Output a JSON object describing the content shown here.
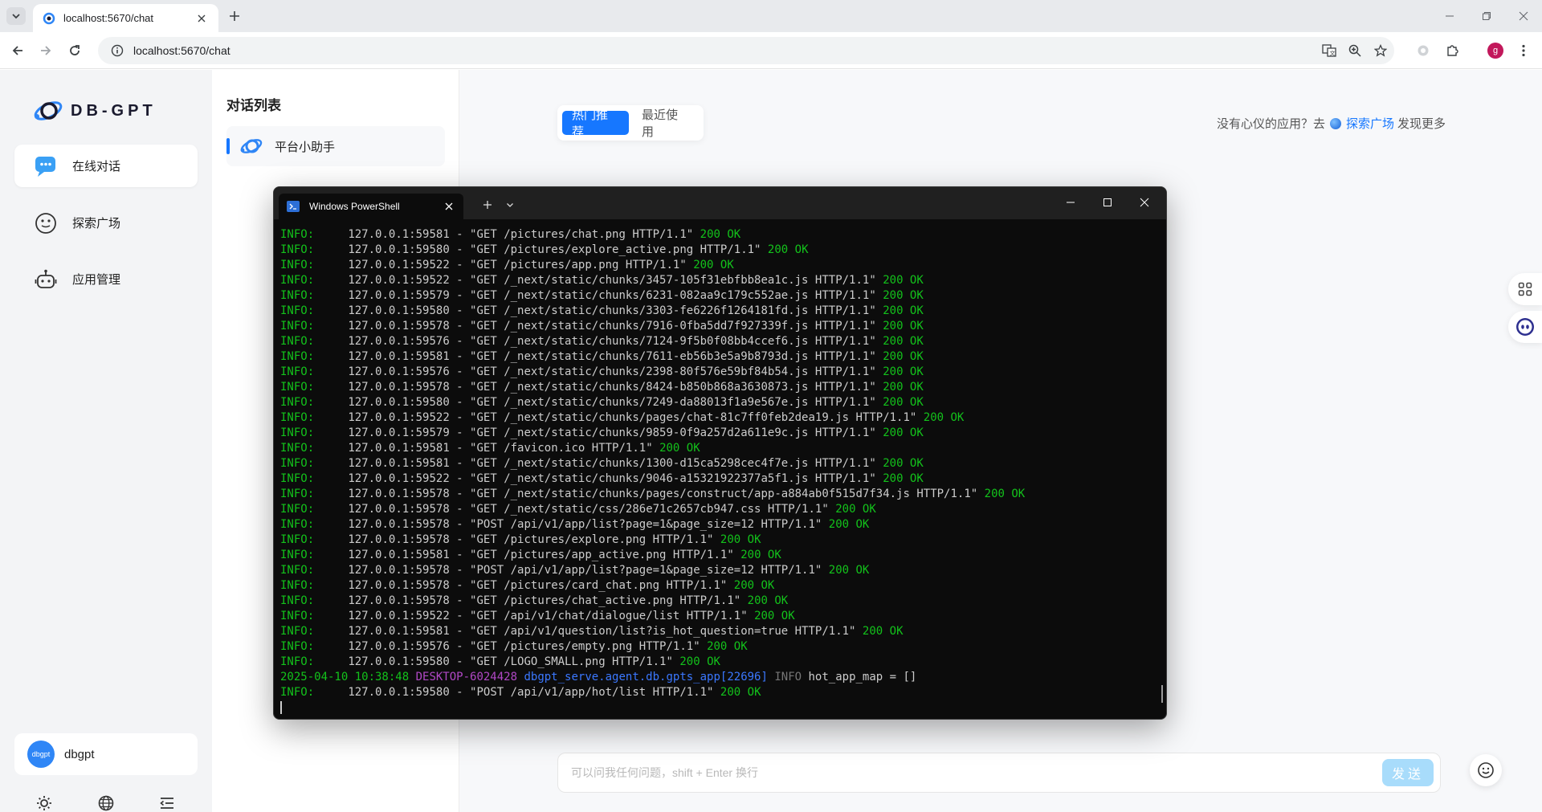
{
  "browser": {
    "tab_title": "localhost:5670/chat",
    "url": "localhost:5670/chat",
    "profile_initial": "g"
  },
  "sidebar": {
    "logo_text": "DB-GPT",
    "items": [
      {
        "label": "在线对话",
        "icon": "chat-bubble-icon",
        "active": true
      },
      {
        "label": "探索广场",
        "icon": "explore-face-icon",
        "active": false
      },
      {
        "label": "应用管理",
        "icon": "robot-icon",
        "active": false
      }
    ],
    "user": {
      "avatar_text": "dbgpt",
      "name": "dbgpt"
    }
  },
  "conversations": {
    "title": "对话列表",
    "items": [
      {
        "label": "平台小助手"
      }
    ]
  },
  "main": {
    "tabs": [
      {
        "label": "热门推荐",
        "active": true
      },
      {
        "label": "最近使用",
        "active": false
      }
    ],
    "hint_prefix": "没有心仪的应用？去",
    "hint_link": "探索广场",
    "hint_suffix": "发现更多",
    "input_placeholder": "可以问我任何问题，shift + Enter 换行",
    "send_label": "发送"
  },
  "powershell": {
    "tab_title": "Windows PowerShell",
    "lines": [
      {
        "lvl": "INFO:",
        "addr": "127.0.0.1:59581",
        "req": "\"GET /pictures/chat.png HTTP/1.1\"",
        "status": "200 OK"
      },
      {
        "lvl": "INFO:",
        "addr": "127.0.0.1:59580",
        "req": "\"GET /pictures/explore_active.png HTTP/1.1\"",
        "status": "200 OK"
      },
      {
        "lvl": "INFO:",
        "addr": "127.0.0.1:59522",
        "req": "\"GET /pictures/app.png HTTP/1.1\"",
        "status": "200 OK"
      },
      {
        "lvl": "INFO:",
        "addr": "127.0.0.1:59522",
        "req": "\"GET /_next/static/chunks/3457-105f31ebfbb8ea1c.js HTTP/1.1\"",
        "status": "200 OK"
      },
      {
        "lvl": "INFO:",
        "addr": "127.0.0.1:59579",
        "req": "\"GET /_next/static/chunks/6231-082aa9c179c552ae.js HTTP/1.1\"",
        "status": "200 OK"
      },
      {
        "lvl": "INFO:",
        "addr": "127.0.0.1:59580",
        "req": "\"GET /_next/static/chunks/3303-fe6226f1264181fd.js HTTP/1.1\"",
        "status": "200 OK"
      },
      {
        "lvl": "INFO:",
        "addr": "127.0.0.1:59578",
        "req": "\"GET /_next/static/chunks/7916-0fba5dd7f927339f.js HTTP/1.1\"",
        "status": "200 OK"
      },
      {
        "lvl": "INFO:",
        "addr": "127.0.0.1:59576",
        "req": "\"GET /_next/static/chunks/7124-9f5b0f08bb4ccef6.js HTTP/1.1\"",
        "status": "200 OK"
      },
      {
        "lvl": "INFO:",
        "addr": "127.0.0.1:59581",
        "req": "\"GET /_next/static/chunks/7611-eb56b3e5a9b8793d.js HTTP/1.1\"",
        "status": "200 OK"
      },
      {
        "lvl": "INFO:",
        "addr": "127.0.0.1:59576",
        "req": "\"GET /_next/static/chunks/2398-80f576e59bf84b54.js HTTP/1.1\"",
        "status": "200 OK"
      },
      {
        "lvl": "INFO:",
        "addr": "127.0.0.1:59578",
        "req": "\"GET /_next/static/chunks/8424-b850b868a3630873.js HTTP/1.1\"",
        "status": "200 OK"
      },
      {
        "lvl": "INFO:",
        "addr": "127.0.0.1:59580",
        "req": "\"GET /_next/static/chunks/7249-da88013f1a9e567e.js HTTP/1.1\"",
        "status": "200 OK"
      },
      {
        "lvl": "INFO:",
        "addr": "127.0.0.1:59522",
        "req": "\"GET /_next/static/chunks/pages/chat-81c7ff0feb2dea19.js HTTP/1.1\"",
        "status": "200 OK"
      },
      {
        "lvl": "INFO:",
        "addr": "127.0.0.1:59579",
        "req": "\"GET /_next/static/chunks/9859-0f9a257d2a611e9c.js HTTP/1.1\"",
        "status": "200 OK"
      },
      {
        "lvl": "INFO:",
        "addr": "127.0.0.1:59581",
        "req": "\"GET /favicon.ico HTTP/1.1\"",
        "status": "200 OK"
      },
      {
        "lvl": "INFO:",
        "addr": "127.0.0.1:59581",
        "req": "\"GET /_next/static/chunks/1300-d15ca5298cec4f7e.js HTTP/1.1\"",
        "status": "200 OK"
      },
      {
        "lvl": "INFO:",
        "addr": "127.0.0.1:59522",
        "req": "\"GET /_next/static/chunks/9046-a15321922377a5f1.js HTTP/1.1\"",
        "status": "200 OK"
      },
      {
        "lvl": "INFO:",
        "addr": "127.0.0.1:59578",
        "req": "\"GET /_next/static/chunks/pages/construct/app-a884ab0f515d7f34.js HTTP/1.1\"",
        "status": "200 OK"
      },
      {
        "lvl": "INFO:",
        "addr": "127.0.0.1:59578",
        "req": "\"GET /_next/static/css/286e71c2657cb947.css HTTP/1.1\"",
        "status": "200 OK"
      },
      {
        "lvl": "INFO:",
        "addr": "127.0.0.1:59578",
        "req": "\"POST /api/v1/app/list?page=1&page_size=12 HTTP/1.1\"",
        "status": "200 OK"
      },
      {
        "lvl": "INFO:",
        "addr": "127.0.0.1:59578",
        "req": "\"GET /pictures/explore.png HTTP/1.1\"",
        "status": "200 OK"
      },
      {
        "lvl": "INFO:",
        "addr": "127.0.0.1:59581",
        "req": "\"GET /pictures/app_active.png HTTP/1.1\"",
        "status": "200 OK"
      },
      {
        "lvl": "INFO:",
        "addr": "127.0.0.1:59578",
        "req": "\"POST /api/v1/app/list?page=1&page_size=12 HTTP/1.1\"",
        "status": "200 OK"
      },
      {
        "lvl": "INFO:",
        "addr": "127.0.0.1:59578",
        "req": "\"GET /pictures/card_chat.png HTTP/1.1\"",
        "status": "200 OK"
      },
      {
        "lvl": "INFO:",
        "addr": "127.0.0.1:59578",
        "req": "\"GET /pictures/chat_active.png HTTP/1.1\"",
        "status": "200 OK"
      },
      {
        "lvl": "INFO:",
        "addr": "127.0.0.1:59522",
        "req": "\"GET /api/v1/chat/dialogue/list HTTP/1.1\"",
        "status": "200 OK"
      },
      {
        "lvl": "INFO:",
        "addr": "127.0.0.1:59581",
        "req": "\"GET /api/v1/question/list?is_hot_question=true HTTP/1.1\"",
        "status": "200 OK"
      },
      {
        "lvl": "INFO:",
        "addr": "127.0.0.1:59576",
        "req": "\"GET /pictures/empty.png HTTP/1.1\"",
        "status": "200 OK"
      },
      {
        "lvl": "INFO:",
        "addr": "127.0.0.1:59580",
        "req": "\"GET /LOGO_SMALL.png HTTP/1.1\"",
        "status": "200 OK"
      },
      {
        "kind": "log",
        "time": "2025-04-10 10:38:48",
        "host": "DESKTOP-6024428",
        "module": "dbgpt_serve.agent.db.gpts_app[22696]",
        "level": "INFO",
        "msg": "hot_app_map = []"
      },
      {
        "lvl": "INFO:",
        "addr": "127.0.0.1:59580",
        "req": "\"POST /api/v1/app/hot/list HTTP/1.1\"",
        "status": "200 OK"
      }
    ]
  },
  "colors": {
    "accent": "#1677ff",
    "terminal_green": "#13c21b",
    "terminal_bg": "#0c0c0c"
  }
}
